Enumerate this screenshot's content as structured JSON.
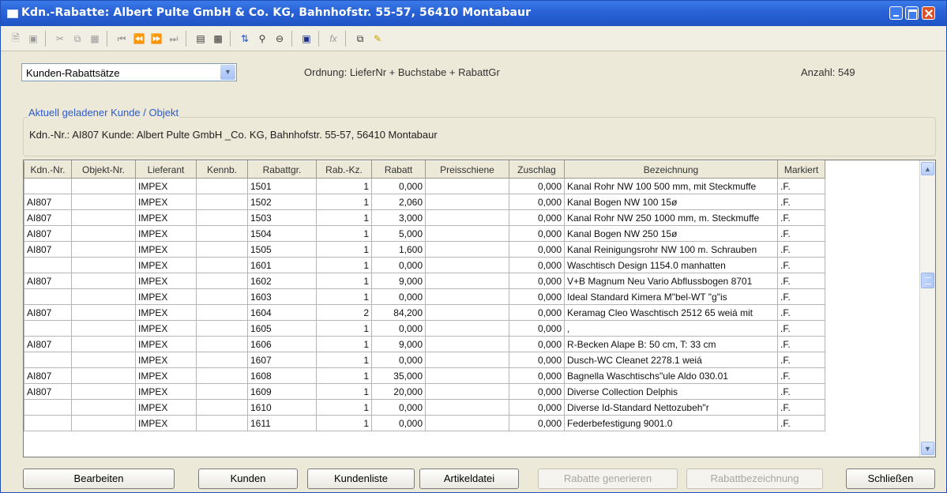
{
  "window": {
    "title": "Kdn.-Rabatte: Albert Pulte GmbH & Co. KG, Bahnhofstr. 55-57, 56410 Montabaur"
  },
  "toolbar": {
    "icons": [
      "new-document",
      "delete",
      "cut",
      "copy",
      "paste",
      "first-record",
      "prev-record",
      "next-record",
      "last-record",
      "form-view",
      "table-view",
      "sort",
      "search",
      "search-minus",
      "record-view",
      "formula",
      "window-tile",
      "highlighter"
    ]
  },
  "filter": {
    "selected": "Kunden-Rabattsätze",
    "ordnung": "Ordnung: LieferNr + Buchstabe + RabattGr",
    "anzahl": "Anzahl: 549"
  },
  "kunde": {
    "group_title": "Aktuell geladener Kunde / Objekt",
    "line": "Kdn.-Nr.: AI807 Kunde: Albert Pulte GmbH _Co. KG, Bahnhofstr. 55-57, 56410 Montabaur"
  },
  "grid": {
    "columns": [
      "Kdn.-Nr.",
      "Objekt-Nr.",
      "Lieferant",
      "Kennb.",
      "Rabattgr.",
      "Rab.-Kz.",
      "Rabatt",
      "Preisschiene",
      "Zuschlag",
      "Bezeichnung",
      "Markiert"
    ],
    "rows": [
      [
        "",
        "",
        "IMPEX",
        "",
        "1501",
        "1",
        "0,000",
        "",
        "0,000",
        "Kanal Rohr NW 100 500 mm, mit Steckmuffe",
        ".F."
      ],
      [
        "AI807",
        "",
        "IMPEX",
        "",
        "1502",
        "1",
        "2,060",
        "",
        "0,000",
        "Kanal Bogen NW 100 15ø",
        ".F."
      ],
      [
        "AI807",
        "",
        "IMPEX",
        "",
        "1503",
        "1",
        "3,000",
        "",
        "0,000",
        "Kanal Rohr NW 250 1000 mm, m. Steckmuffe",
        ".F."
      ],
      [
        "AI807",
        "",
        "IMPEX",
        "",
        "1504",
        "1",
        "5,000",
        "",
        "0,000",
        "Kanal Bogen NW 250 15ø",
        ".F."
      ],
      [
        "AI807",
        "",
        "IMPEX",
        "",
        "1505",
        "1",
        "1,600",
        "",
        "0,000",
        "Kanal Reinigungsrohr NW 100 m. Schrauben",
        ".F."
      ],
      [
        "",
        "",
        "IMPEX",
        "",
        "1601",
        "1",
        "0,000",
        "",
        "0,000",
        "Waschtisch Design 1154.0 manhatten",
        ".F."
      ],
      [
        "AI807",
        "",
        "IMPEX",
        "",
        "1602",
        "1",
        "9,000",
        "",
        "0,000",
        "V+B Magnum Neu Vario Abflussbogen 8701",
        ".F."
      ],
      [
        "",
        "",
        "IMPEX",
        "",
        "1603",
        "1",
        "0,000",
        "",
        "0,000",
        "Ideal Standard Kimera M\"bel-WT \"g\"is",
        ".F."
      ],
      [
        "AI807",
        "",
        "IMPEX",
        "",
        "1604",
        "2",
        "84,200",
        "",
        "0,000",
        "Keramag Cleo Waschtisch 2512 65 weiá mit",
        ".F."
      ],
      [
        "",
        "",
        "IMPEX",
        "",
        "1605",
        "1",
        "0,000",
        "",
        "0,000",
        ",",
        ".F."
      ],
      [
        "AI807",
        "",
        "IMPEX",
        "",
        "1606",
        "1",
        "9,000",
        "",
        "0,000",
        "R-Becken Alape B: 50 cm, T: 33 cm",
        ".F."
      ],
      [
        "",
        "",
        "IMPEX",
        "",
        "1607",
        "1",
        "0,000",
        "",
        "0,000",
        "Dusch-WC Cleanet 2278.1 weiá",
        ".F."
      ],
      [
        "AI807",
        "",
        "IMPEX",
        "",
        "1608",
        "1",
        "35,000",
        "",
        "0,000",
        "Bagnella Waschtischs\"ule Aldo 030.01",
        ".F."
      ],
      [
        "AI807",
        "",
        "IMPEX",
        "",
        "1609",
        "1",
        "20,000",
        "",
        "0,000",
        "Diverse Collection Delphis",
        ".F."
      ],
      [
        "",
        "",
        "IMPEX",
        "",
        "1610",
        "1",
        "0,000",
        "",
        "0,000",
        "Diverse Id-Standard Nettozubeh\"r",
        ".F."
      ],
      [
        "",
        "",
        "IMPEX",
        "",
        "1611",
        "1",
        "0,000",
        "",
        "0,000",
        "Federbefestigung 9001.0",
        ".F."
      ]
    ]
  },
  "buttons": {
    "bearbeiten": "Bearbeiten",
    "kunden": "Kunden",
    "kundenliste": "Kundenliste",
    "artikeldatei": "Artikeldatei",
    "rabatte_generieren": "Rabatte generieren",
    "rabattbezeichnung": "Rabattbezeichnung",
    "schliessen": "Schließen"
  }
}
